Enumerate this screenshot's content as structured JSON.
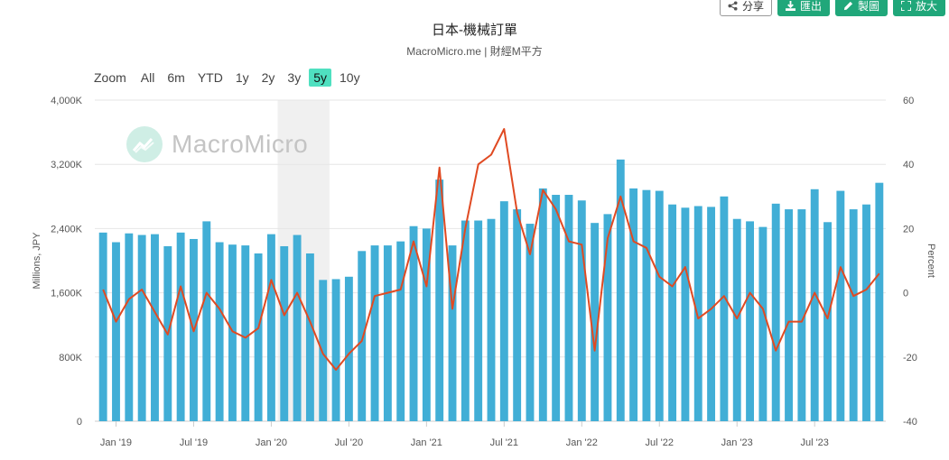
{
  "toolbar": {
    "share_label": "分享",
    "export_label": "匯出",
    "draw_label": "製圖",
    "expand_label": "放大"
  },
  "header": {
    "title": "日本-機械訂單",
    "subtitle": "MacroMicro.me | 財經M平方"
  },
  "range_selector": {
    "zoom_label": "Zoom",
    "options": [
      "All",
      "6m",
      "YTD",
      "1y",
      "2y",
      "3y",
      "5y",
      "10y"
    ],
    "selected": "5y"
  },
  "watermark": {
    "text": "MacroMicro"
  },
  "colors": {
    "bar": "#41aed6",
    "line": "#e04a22",
    "recession_band": "#f0f0f0",
    "accent": "#20a77a",
    "range_active": "#4fe0c0"
  },
  "chart_data": {
    "type": "bar",
    "x": [
      "2018-12",
      "2019-01",
      "2019-02",
      "2019-03",
      "2019-04",
      "2019-05",
      "2019-06",
      "2019-07",
      "2019-08",
      "2019-09",
      "2019-10",
      "2019-11",
      "2019-12",
      "2020-01",
      "2020-02",
      "2020-03",
      "2020-04",
      "2020-05",
      "2020-06",
      "2020-07",
      "2020-08",
      "2020-09",
      "2020-10",
      "2020-11",
      "2020-12",
      "2021-01",
      "2021-02",
      "2021-03",
      "2021-04",
      "2021-05",
      "2021-06",
      "2021-07",
      "2021-08",
      "2021-09",
      "2021-10",
      "2021-11",
      "2021-12",
      "2022-01",
      "2022-02",
      "2022-03",
      "2022-04",
      "2022-05",
      "2022-06",
      "2022-07",
      "2022-08",
      "2022-09",
      "2022-10",
      "2022-11",
      "2022-12",
      "2023-01",
      "2023-02",
      "2023-03",
      "2023-04",
      "2023-05",
      "2023-06",
      "2023-07",
      "2023-08",
      "2023-09",
      "2023-10",
      "2023-11",
      "2023-12"
    ],
    "series": [
      {
        "name": "",
        "type": "bar",
        "axis": "left",
        "values": [
          2350000,
          2230000,
          2340000,
          2320000,
          2330000,
          2180000,
          2350000,
          2270000,
          2490000,
          2230000,
          2200000,
          2190000,
          2090000,
          2330000,
          2180000,
          2320000,
          2090000,
          1760000,
          1770000,
          1800000,
          2120000,
          2190000,
          2190000,
          2240000,
          2430000,
          2400000,
          3010000,
          2190000,
          2500000,
          2500000,
          2520000,
          2740000,
          2640000,
          2460000,
          2900000,
          2820000,
          2820000,
          2750000,
          2470000,
          2580000,
          3260000,
          2900000,
          2880000,
          2870000,
          2700000,
          2660000,
          2680000,
          2670000,
          2800000,
          2520000,
          2490000,
          2420000,
          2710000,
          2640000,
          2640000,
          2890000,
          2480000,
          2870000,
          2640000,
          2700000,
          2970000
        ]
      },
      {
        "name": "",
        "type": "line",
        "axis": "right",
        "values": [
          1,
          -9,
          -2,
          1,
          -6,
          -13,
          2,
          -12,
          0,
          -5,
          -12,
          -14,
          -11,
          4,
          -7,
          0,
          -9,
          -19,
          -24,
          -19,
          -15,
          -1,
          0,
          1,
          16,
          2,
          39,
          -5,
          20,
          40,
          43,
          51,
          25,
          12,
          32,
          26,
          16,
          15,
          -18,
          17,
          30,
          16,
          14,
          5,
          2,
          8,
          -8,
          -5,
          -1,
          -8,
          0,
          -5,
          -18,
          -9,
          -9,
          0,
          -8,
          8,
          -1,
          1,
          6
        ]
      }
    ],
    "x_tick_labels": [
      "Jan '19",
      "Jul '19",
      "Jan '20",
      "Jul '20",
      "Jan '21",
      "Jul '21",
      "Jan '22",
      "Jul '22",
      "Jan '23",
      "Jul '23"
    ],
    "y_left": {
      "label": "Millions, JPY",
      "range": [
        0,
        4000000
      ],
      "ticks": [
        "0",
        "800K",
        "1,600K",
        "2,400K",
        "3,200K",
        "4,000K"
      ],
      "values": [
        0,
        800000,
        1600000,
        2400000,
        3200000,
        4000000
      ]
    },
    "y_right": {
      "label": "Percent",
      "range": [
        -40,
        60
      ],
      "ticks": [
        "-40",
        "-20",
        "0",
        "20",
        "40",
        "60"
      ],
      "values": [
        -40,
        -20,
        0,
        20,
        40,
        60
      ]
    },
    "shaded_band": {
      "from": "2020-02",
      "to": "2020-05"
    },
    "grid": true
  }
}
